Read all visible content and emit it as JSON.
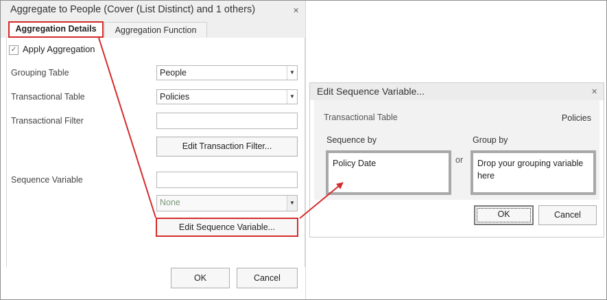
{
  "left_panel": {
    "title": "Aggregate to People (Cover (List Distinct) and 1 others)",
    "tabs": [
      {
        "label": "Aggregation Details",
        "active": true
      },
      {
        "label": "Aggregation Function",
        "active": false
      }
    ],
    "apply_aggregation": {
      "label": "Apply Aggregation",
      "checked": true
    },
    "fields": {
      "grouping_table": {
        "label": "Grouping Table",
        "value": "People"
      },
      "transactional_table": {
        "label": "Transactional Table",
        "value": "Policies"
      },
      "transactional_filter": {
        "label": "Transactional Filter",
        "value": ""
      },
      "sequence_variable": {
        "label": "Sequence Variable",
        "value": "",
        "select_value": "None"
      }
    },
    "buttons": {
      "edit_transaction_filter": "Edit Transaction Filter...",
      "edit_sequence_variable": "Edit Sequence Variable...",
      "ok": "OK",
      "cancel": "Cancel"
    }
  },
  "dialog": {
    "title": "Edit Sequence Variable...",
    "transactional_table_label": "Transactional Table",
    "transactional_table_value": "Policies",
    "sequence_by_label": "Sequence by",
    "sequence_by_value": "Policy Date",
    "or_label": "or",
    "group_by_label": "Group by",
    "group_by_placeholder": "Drop your grouping variable here",
    "ok": "OK",
    "cancel": "Cancel"
  },
  "colors": {
    "annotation_red": "#d42a2a",
    "title_bar": "#efefef",
    "dialog_body": "#f2f2f2"
  },
  "icons": {
    "close": "close-icon",
    "dropdown": "chevron-down-icon",
    "checkmark": "check-icon"
  }
}
